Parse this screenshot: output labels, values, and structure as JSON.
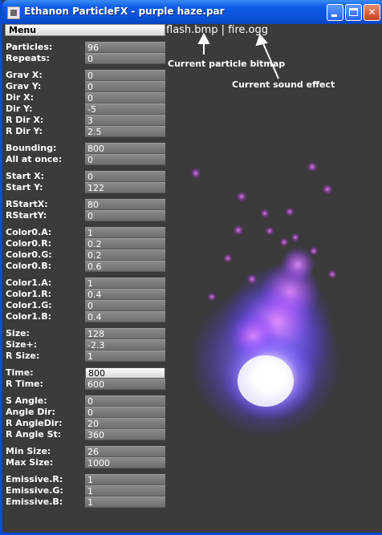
{
  "window": {
    "title": "Ethanon ParticleFX - purple haze.par",
    "minimize_label": "_",
    "maximize_label": "□",
    "close_label": "✕"
  },
  "menu_label": "Menu",
  "files": {
    "bitmap": "flash.bmp",
    "separator": "|",
    "sound": "fire.ogg"
  },
  "annotations": {
    "bitmap_note": "Current particle bitmap",
    "sound_note": "Current sound effect"
  },
  "params": [
    {
      "label": "Particles:",
      "value": "96"
    },
    {
      "label": "Repeats:",
      "value": "0"
    },
    {
      "label": "Grav X:",
      "value": "0"
    },
    {
      "label": "Grav Y:",
      "value": "0"
    },
    {
      "label": "Dir X:",
      "value": "0"
    },
    {
      "label": "Dir Y:",
      "value": "-5"
    },
    {
      "label": "R Dir X:",
      "value": "3"
    },
    {
      "label": "R Dir Y:",
      "value": "2.5"
    },
    {
      "label": "Bounding:",
      "value": "800"
    },
    {
      "label": "All at once:",
      "value": "0"
    },
    {
      "label": "Start X:",
      "value": "0"
    },
    {
      "label": "Start Y:",
      "value": "122"
    },
    {
      "label": "RStartX:",
      "value": "80"
    },
    {
      "label": "RStartY:",
      "value": "0"
    },
    {
      "label": "Color0.A:",
      "value": "1"
    },
    {
      "label": "Color0.R:",
      "value": "0.2"
    },
    {
      "label": "Color0.G:",
      "value": "0.2"
    },
    {
      "label": "Color0.B:",
      "value": "0.6"
    },
    {
      "label": "Color1.A:",
      "value": "1"
    },
    {
      "label": "Color1.R:",
      "value": "0.4"
    },
    {
      "label": "Color1.G:",
      "value": "0"
    },
    {
      "label": "Color1.B:",
      "value": "0.4"
    },
    {
      "label": "Size:",
      "value": "128"
    },
    {
      "label": "Size+:",
      "value": "-2.3"
    },
    {
      "label": "R Size:",
      "value": "1"
    },
    {
      "label": "Time:",
      "value": "800"
    },
    {
      "label": "R Time:",
      "value": "600"
    },
    {
      "label": "S Angle:",
      "value": "0"
    },
    {
      "label": "Angle Dir:",
      "value": "0"
    },
    {
      "label": "R AngleDir:",
      "value": "20"
    },
    {
      "label": "R Angle St:",
      "value": "360"
    },
    {
      "label": "Min Size:",
      "value": "26"
    },
    {
      "label": "Max Size:",
      "value": "1000"
    },
    {
      "label": "Emissive.R:",
      "value": "1"
    },
    {
      "label": "Emissive.G:",
      "value": "1"
    },
    {
      "label": "Emissive.B:",
      "value": "1"
    }
  ],
  "active_field": "Time:",
  "colors": {
    "background": "#3b3b3b",
    "titlebar": "#0a52d8",
    "particle_core": "#ffffff",
    "particle_mid": "#8866ff",
    "particle_edge": "#cc44ff"
  }
}
